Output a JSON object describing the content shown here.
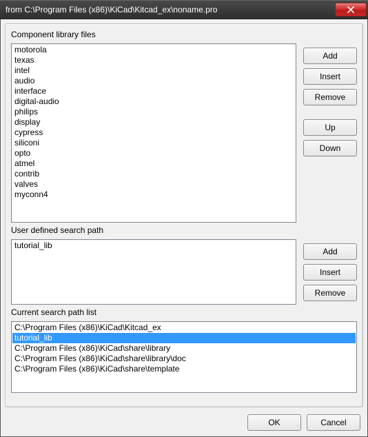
{
  "window": {
    "title": "from C:\\Program Files (x86)\\KiCad\\Kitcad_ex\\noname.pro"
  },
  "sections": {
    "libs_label": "Component library files",
    "user_path_label": "User defined search path",
    "search_list_label": "Current search path list"
  },
  "lib_items": [
    "motorola",
    "texas",
    "intel",
    "audio",
    "interface",
    "digital-audio",
    "philips",
    "display",
    "cypress",
    "siliconi",
    "opto",
    "atmel",
    "contrib",
    "valves",
    "myconn4"
  ],
  "user_paths": [
    "tutorial_lib"
  ],
  "search_paths": [
    "C:\\Program Files (x86)\\KiCad\\Kitcad_ex",
    "tutorial_lib",
    "C:\\Program Files (x86)\\KiCad\\share\\library",
    "C:\\Program Files (x86)\\KiCad\\share\\library\\doc",
    "C:\\Program Files (x86)\\KiCad\\share\\template"
  ],
  "search_selected_index": 1,
  "buttons": {
    "add": "Add",
    "insert": "Insert",
    "remove": "Remove",
    "up": "Up",
    "down": "Down",
    "ok": "OK",
    "cancel": "Cancel"
  }
}
